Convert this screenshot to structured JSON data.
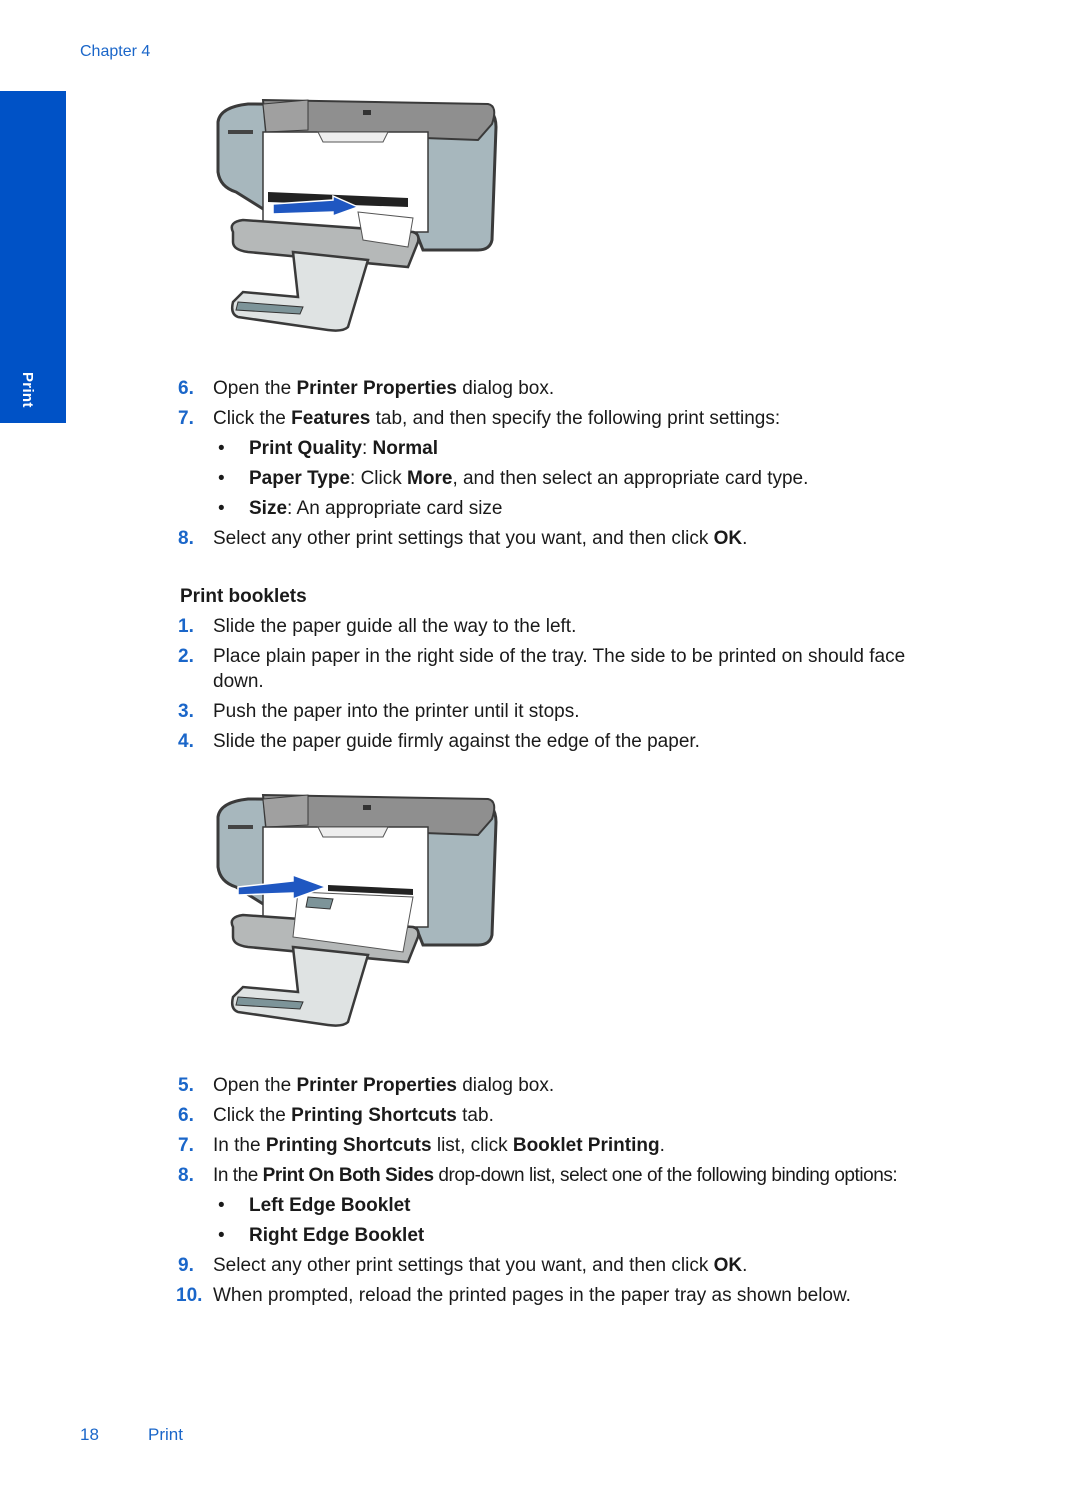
{
  "header": {
    "chapter": "Chapter 4"
  },
  "side_tab": {
    "label": "Print",
    "color": "#0052c6"
  },
  "accent_color": "#1a66c9",
  "figures": [
    {
      "name": "printer-card-loading-illustration",
      "icon": "printer-icon"
    },
    {
      "name": "printer-booklet-paper-loading-illustration",
      "icon": "printer-icon"
    }
  ],
  "steps_a": [
    {
      "num": "6.",
      "parts": [
        "Open the ",
        "Printer Properties",
        " dialog box."
      ]
    },
    {
      "num": "7.",
      "parts": [
        "Click the ",
        "Features",
        " tab, and then specify the following print settings:"
      ]
    },
    {
      "num": "8.",
      "parts": [
        "Select any other print settings that you want, and then click ",
        "OK",
        "."
      ]
    }
  ],
  "bullets_a": [
    {
      "bold1": "Print Quality",
      "sep": ": ",
      "bold2": "Normal",
      "rest": ""
    },
    {
      "bold1": "Paper Type",
      "sep": ": Click ",
      "bold2": "More",
      "rest": ", and then select an appropriate card type."
    },
    {
      "bold1": "Size",
      "sep": ": An appropriate card size",
      "bold2": "",
      "rest": ""
    }
  ],
  "section": {
    "heading": "Print booklets",
    "steps_b": [
      {
        "num": "1.",
        "text": "Slide the paper guide all the way to the left."
      },
      {
        "num": "2.",
        "text": "Place plain paper in the right side of the tray. The side to be printed on should face",
        "text2": "down."
      },
      {
        "num": "3.",
        "text": "Push the paper into the printer until it stops."
      },
      {
        "num": "4.",
        "text": "Slide the paper guide firmly against the edge of the paper."
      }
    ],
    "steps_c": [
      {
        "num": "5.",
        "parts": [
          "Open the ",
          "Printer Properties",
          " dialog box."
        ]
      },
      {
        "num": "6.",
        "parts": [
          "Click the ",
          "Printing Shortcuts",
          " tab."
        ]
      },
      {
        "num": "7.",
        "parts": [
          "In the ",
          "Printing Shortcuts",
          " list, click ",
          "Booklet Printing",
          "."
        ]
      },
      {
        "num": "8.",
        "parts": [
          "In the ",
          "Print On Both Sides",
          " drop-down list, select one of the following binding options:"
        ]
      },
      {
        "num": "9.",
        "parts": [
          "Select any other print settings that you want, and then click ",
          "OK",
          "."
        ]
      },
      {
        "num": "10.",
        "parts": [
          "When prompted, reload the printed pages in the paper tray as shown below."
        ]
      }
    ],
    "bullets_c": [
      "Left Edge Booklet",
      "Right Edge Booklet"
    ]
  },
  "footer": {
    "page_number": "18",
    "section": "Print"
  }
}
